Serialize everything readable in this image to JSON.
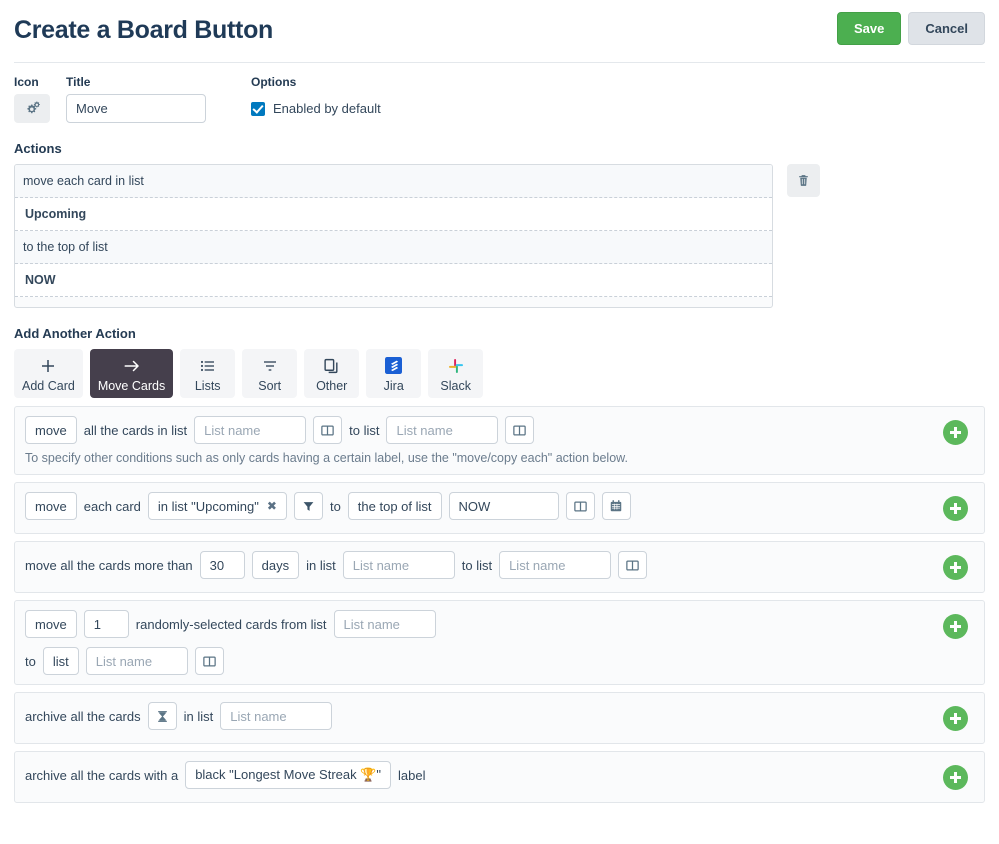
{
  "header": {
    "title": "Create a Board Button",
    "save_label": "Save",
    "cancel_label": "Cancel"
  },
  "meta": {
    "icon_label": "Icon",
    "icon_name": "cogs-icon",
    "title_label": "Title",
    "title_value": "Move",
    "options_label": "Options",
    "enabled_label": "Enabled by default",
    "enabled_checked": true
  },
  "actions": {
    "section_title": "Actions",
    "summary_lines": [
      {
        "text": "move each card in list",
        "style": "plain"
      },
      {
        "text": "Upcoming",
        "style": "bold"
      },
      {
        "text": "to the top of list",
        "style": "plain"
      },
      {
        "text": "NOW",
        "style": "bold"
      },
      {
        "text": "",
        "style": "tail"
      }
    ],
    "delete_name": "trash-icon"
  },
  "add_another": {
    "section_title": "Add Another Action",
    "tabs": [
      {
        "label": "Add Card",
        "icon": "plus-icon",
        "active": false
      },
      {
        "label": "Move Cards",
        "icon": "arrow-right-icon",
        "active": true
      },
      {
        "label": "Lists",
        "icon": "list-icon",
        "active": false
      },
      {
        "label": "Sort",
        "icon": "sort-filter-icon",
        "active": false
      },
      {
        "label": "Other",
        "icon": "copy-icon",
        "active": false
      },
      {
        "label": "Jira",
        "icon": "jira-icon",
        "active": false
      },
      {
        "label": "Slack",
        "icon": "slack-icon",
        "active": false
      }
    ]
  },
  "rows": {
    "r1": {
      "verb": "move",
      "t1": "all the cards in list",
      "list_from_placeholder": "List name",
      "board_icon_1": "board-columns-icon",
      "t2": "to list",
      "list_to_placeholder": "List name",
      "board_icon_2": "board-columns-icon",
      "hint": "To specify other conditions such as only cards having a certain label, use the \"move/copy each\" action below.",
      "add_label": "add-action-button"
    },
    "r2": {
      "verb": "move",
      "t1": "each card",
      "chip": "in list \"Upcoming\"",
      "chip_remove": "✖",
      "filter_icon": "filter-icon",
      "t2": "to",
      "position": "the top of list",
      "target": "NOW",
      "board_icon": "board-columns-icon",
      "calendar_icon": "calendar-icon"
    },
    "r3": {
      "t1": "move all the cards more than",
      "days_value": "30",
      "unit": "days",
      "t2": "in list",
      "list_from_placeholder": "List name",
      "t3": "to list",
      "list_to_placeholder": "List name",
      "board_icon": "board-columns-icon"
    },
    "r4": {
      "verb": "move",
      "count": "1",
      "t1": "randomly-selected cards from list",
      "list_from_placeholder": "List name",
      "t2": "to",
      "target_kind": "list",
      "list_to_placeholder": "List name",
      "board_icon": "board-columns-icon"
    },
    "r5": {
      "t1": "archive all the cards",
      "hourglass_icon": "hourglass-icon",
      "t2": "in list",
      "list_placeholder": "List name"
    },
    "r6": {
      "t1": "archive all the cards with a",
      "label_value": "black \"Longest Move Streak 🏆\"",
      "t2": "label"
    }
  },
  "colors": {
    "save_green": "#4caf50",
    "plus_green": "#5cb85c",
    "active_tab": "#453f4c",
    "checkbox_blue": "#0079bf",
    "jira_blue": "#2684ff",
    "text": "#33475b"
  }
}
